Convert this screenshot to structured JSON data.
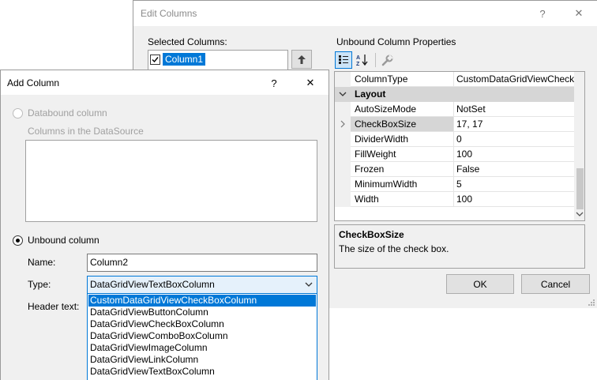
{
  "edit_columns": {
    "title": "Edit Columns",
    "help_glyph": "?",
    "close_glyph": "✕",
    "selected_columns_label": "Selected Columns:",
    "selected_columns": [
      {
        "name": "Column1",
        "checked": true
      }
    ],
    "properties_label": "Unbound Column Properties",
    "grid": {
      "top_row": {
        "name": "ColumnType",
        "value": "CustomDataGridViewCheck"
      },
      "category": "Layout",
      "rows": [
        {
          "name": "AutoSizeMode",
          "value": "NotSet"
        },
        {
          "name": "CheckBoxSize",
          "value": "17, 17"
        },
        {
          "name": "DividerWidth",
          "value": "0"
        },
        {
          "name": "FillWeight",
          "value": "100"
        },
        {
          "name": "Frozen",
          "value": "False"
        },
        {
          "name": "MinimumWidth",
          "value": "5"
        },
        {
          "name": "Width",
          "value": "100"
        }
      ]
    },
    "description": {
      "title": "CheckBoxSize",
      "text": "The size of the check box."
    },
    "ok_label": "OK",
    "cancel_label": "Cancel"
  },
  "add_column": {
    "title": "Add Column",
    "help_glyph": "?",
    "close_glyph": "✕",
    "databound_label": "Databound column",
    "datasource_label": "Columns in the DataSource",
    "unbound_label": "Unbound column",
    "name_label": "Name:",
    "name_value": "Column2",
    "type_label": "Type:",
    "type_value": "DataGridViewTextBoxColumn",
    "header_text_label": "Header text:",
    "type_options": [
      "CustomDataGridViewCheckBoxColumn",
      "DataGridViewButtonColumn",
      "DataGridViewCheckBoxColumn",
      "DataGridViewComboBoxColumn",
      "DataGridViewImageColumn",
      "DataGridViewLinkColumn",
      "DataGridViewTextBoxColumn"
    ]
  },
  "colors": {
    "accent": "#0078d7",
    "selection_text": "#ffffff",
    "dialog_bg": "#f0f0f0"
  }
}
